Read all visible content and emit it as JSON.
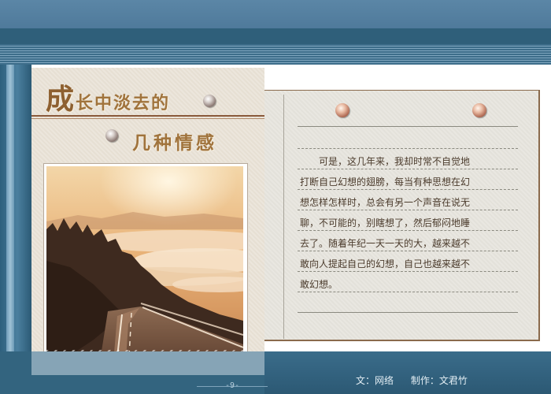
{
  "title": {
    "line1_first": "成",
    "line1_rest": "长中淡去的",
    "line2": "几种情感"
  },
  "article": {
    "lines": [
      "　　可是，这几年来，我却时常不自觉地",
      "打断自己幻想的翅膀，每当有种思想在幻",
      "想怎样怎样时，总会有另一个声音在说无",
      "聊，不可能的，别瞎想了，然后郁闷地睡",
      "去了。随着年纪一天一天的大，越来越不",
      "敢向人提起自己的幻想，自己也越来越不",
      "敢幻想。"
    ]
  },
  "footer": {
    "page_number": "-9-",
    "author": "文：网络",
    "producer": "制作：文君竹"
  },
  "icons": {
    "pin": "pushpin-icon"
  },
  "colors": {
    "title_gold": "#a0733c",
    "frame_blue": "#33647f",
    "text_brown": "#4b3b2c"
  }
}
